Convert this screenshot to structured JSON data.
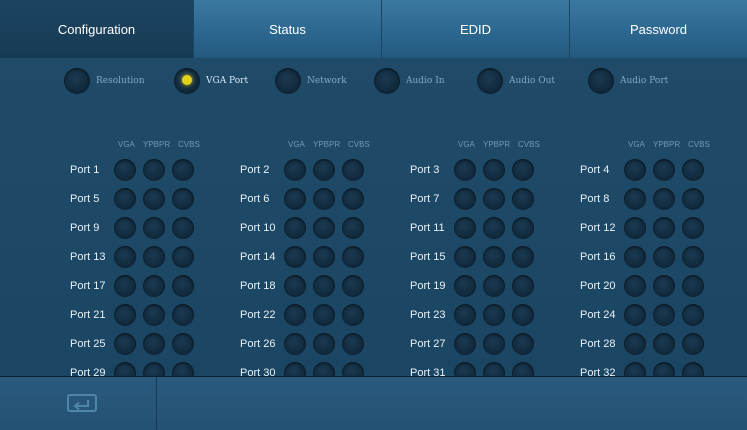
{
  "tabs": [
    {
      "label": "Configuration",
      "active": true
    },
    {
      "label": "Status",
      "active": false
    },
    {
      "label": "EDID",
      "active": false
    },
    {
      "label": "Password",
      "active": false
    }
  ],
  "subnav": [
    {
      "label": "Resolution",
      "selected": false
    },
    {
      "label": "VGA Port",
      "selected": true
    },
    {
      "label": "Network",
      "selected": false
    },
    {
      "label": "Audio In",
      "selected": false
    },
    {
      "label": "Audio Out",
      "selected": false
    },
    {
      "label": "Audio Port",
      "selected": false
    }
  ],
  "columns": [
    "VGA",
    "YPBPR",
    "CVBS"
  ],
  "ports": [
    [
      "Port 1",
      "Port 5",
      "Port 9",
      "Port 13",
      "Port 17",
      "Port 21",
      "Port 25",
      "Port 29"
    ],
    [
      "Port 2",
      "Port 6",
      "Port 10",
      "Port 14",
      "Port 18",
      "Port 22",
      "Port 26",
      "Port 30"
    ],
    [
      "Port 3",
      "Port 7",
      "Port 11",
      "Port 15",
      "Port 19",
      "Port 23",
      "Port 27",
      "Port 31"
    ],
    [
      "Port 4",
      "Port 8",
      "Port 12",
      "Port 16",
      "Port 20",
      "Port 24",
      "Port 28",
      "Port 32"
    ]
  ],
  "footer": {
    "back_icon": "return-icon"
  },
  "colors": {
    "accent_selected": "#e4d21a",
    "tab_bar": "#2c6790",
    "panel": "#1f4b69"
  }
}
